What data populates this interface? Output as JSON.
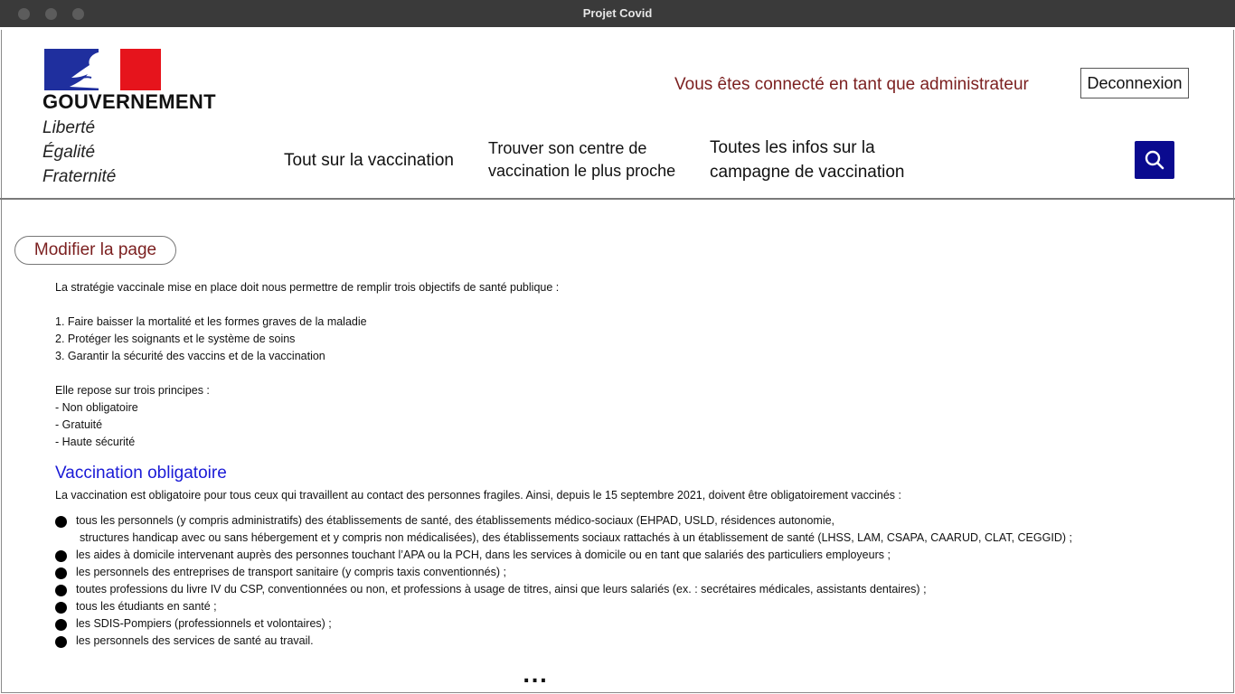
{
  "window": {
    "title": "Projet Covid"
  },
  "header": {
    "logo_text": "GOUVERNEMENT",
    "motto": [
      "Liberté",
      "Égalité",
      "Fraternité"
    ],
    "connected_text": "Vous êtes connecté en tant que administrateur",
    "logout_label": "Deconnexion",
    "nav": {
      "item1": "Tout sur la vaccination",
      "item2_line1": "Trouver son centre de",
      "item2_line2": "vaccination le plus proche",
      "item3_line1": "Toutes les infos sur la",
      "item3_line2": "campagne de vaccination"
    },
    "search_icon": "search-icon"
  },
  "edit_button_label": "Modifier la page",
  "content": {
    "intro": "La stratégie vaccinale mise en place doit nous permettre de remplir trois objectifs de santé publique :",
    "objectives": [
      "1. Faire baisser la mortalité et les formes graves de la maladie",
      "2. Protéger les soignants et le système de soins",
      "3. Garantir la sécurité des vaccins et de la vaccination"
    ],
    "principles_title": "Elle repose sur trois principes :",
    "principles": [
      "- Non obligatoire",
      "- Gratuité",
      "- Haute sécurité"
    ],
    "section_title": "Vaccination obligatoire",
    "section_intro": "La vaccination est obligatoire pour tous ceux qui travaillent au contact des personnes fragiles. Ainsi, depuis le 15 septembre 2021, doivent être obligatoirement vaccinés :",
    "bullets": [
      {
        "line1": "tous les personnels (y compris administratifs) des établissements de santé, des établissements médico-sociaux (EHPAD, USLD, résidences autonomie,",
        "line2": "structures handicap avec ou sans hébergement et y compris non médicalisées), des établissements sociaux rattachés à un établissement de santé (LHSS, LAM, CSAPA, CAARUD, CLAT, CEGGID) ;"
      },
      {
        "line1": "les aides à domicile intervenant auprès des personnes touchant l’APA ou la PCH, dans les services à domicile ou en tant que salariés des particuliers employeurs ;"
      },
      {
        "line1": "les personnels des entreprises de transport sanitaire (y compris taxis conventionnés) ;"
      },
      {
        "line1": "toutes professions du livre IV du CSP, conventionnées ou non, et professions à usage de titres, ainsi que leurs salariés (ex. : secrétaires médicales, assistants dentaires) ;"
      },
      {
        "line1": "tous les étudiants en santé ;"
      },
      {
        "line1": "les SDIS-Pompiers (professionnels et volontaires) ;"
      },
      {
        "line1": "les personnels des services de santé au travail."
      }
    ],
    "more": "..."
  },
  "colors": {
    "accent_red": "#7b1f1f",
    "link_blue": "#1a1ad6",
    "search_bg": "#0a0a8f"
  }
}
